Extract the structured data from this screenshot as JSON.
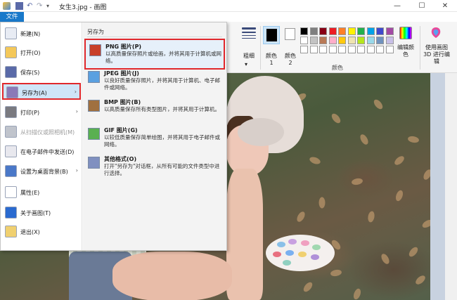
{
  "window": {
    "title": "女生3.jpg - 画图",
    "minimize": "—",
    "maximize": "☐",
    "close": "✕"
  },
  "ribbon_tabs": {
    "file": "文件"
  },
  "ribbon": {
    "size_label": "粗细",
    "color1_label": "颜色 1",
    "color2_label": "颜色 2",
    "edit_colors_label": "编辑颜色",
    "paint3d_label": "使用画图 3D 进行编辑",
    "colors_group_label": "颜色",
    "palette_row1": [
      "#000000",
      "#7f7f7f",
      "#880015",
      "#ed1c24",
      "#ff7f27",
      "#fff200",
      "#22b14c",
      "#00a2e8",
      "#3f48cc",
      "#a349a4"
    ],
    "palette_row2": [
      "#ffffff",
      "#c3c3c3",
      "#b97a57",
      "#ffaec9",
      "#ffc90e",
      "#efe4b0",
      "#b5e61d",
      "#99d9ea",
      "#7092be",
      "#c8bfe7"
    ],
    "palette_row3": [
      "#ffffff",
      "#ffffff",
      "#ffffff",
      "#ffffff",
      "#ffffff",
      "#ffffff",
      "#ffffff",
      "#ffffff",
      "#ffffff",
      "#ffffff"
    ]
  },
  "file_menu": {
    "items": [
      {
        "label": "新建(N)",
        "icon": "new-file-icon",
        "color": "#e8ecf4"
      },
      {
        "label": "打开(O)",
        "icon": "open-folder-icon",
        "color": "#f4c85a"
      },
      {
        "label": "保存(S)",
        "icon": "save-disk-icon",
        "color": "#5a6aa8"
      },
      {
        "label": "另存为(A)",
        "icon": "save-as-icon",
        "color": "#8a7ab8"
      },
      {
        "label": "打印(P)",
        "icon": "printer-icon",
        "color": "#7a7a80"
      },
      {
        "label": "从扫描仪或照相机(M)",
        "icon": "scanner-icon",
        "color": "#c0c4cc"
      },
      {
        "label": "在电子邮件中发送(D)",
        "icon": "email-icon",
        "color": "#e8e8ee"
      },
      {
        "label": "设置为桌面背景(B)",
        "icon": "desktop-background-icon",
        "color": "#4a78c8"
      },
      {
        "label": "属性(E)",
        "icon": "checkmark-icon",
        "color": "#ffffff"
      },
      {
        "label": "关于画图(T)",
        "icon": "info-icon",
        "color": "#2a6ad0"
      },
      {
        "label": "退出(X)",
        "icon": "exit-icon",
        "color": "#f0d070"
      }
    ],
    "save_as_panel": {
      "header": "另存为",
      "options": [
        {
          "title": "PNG 图片(P)",
          "desc": "以高质量保存照片或绘画，并将其用于计算机或网络。",
          "icon": "png-image-icon"
        },
        {
          "title": "JPEG 图片(J)",
          "desc": "以良好质量保存照片，并将其用于计算机、电子邮件或网络。",
          "icon": "jpeg-image-icon"
        },
        {
          "title": "BMP 图片(B)",
          "desc": "以高质量保存所有类型图片，并将其用于计算机。",
          "icon": "bmp-image-icon"
        },
        {
          "title": "GIF 图片(G)",
          "desc": "以较低质量保存简单绘图，并将其用于电子邮件或网络。",
          "icon": "gif-image-icon"
        },
        {
          "title": "其他格式(O)",
          "desc": "打开\"另存为\"对话框，从所有可能的文件类型中进行选择。",
          "icon": "other-format-icon"
        }
      ]
    }
  }
}
